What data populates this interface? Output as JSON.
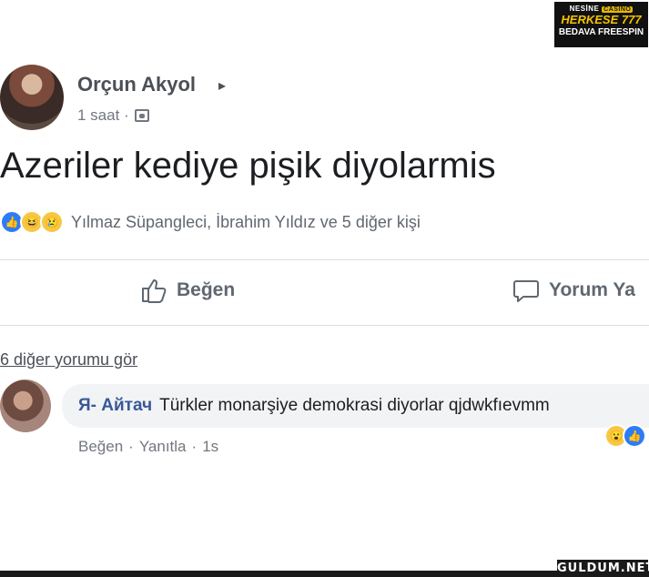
{
  "ad": {
    "brand": "NESİNE",
    "brand_tag": "CASINO",
    "line1": "HERKESE 777",
    "line2": "BEDAVA FREESPIN"
  },
  "post": {
    "author": "Orçun Akyol",
    "author_arrow": "▸",
    "time": "1 saat ·",
    "text": "Azeriler kediye pişik diyolarmis",
    "reactions_text": "Yılmaz Süpangleci, İbrahim Yıldız ve 5 diğer kişi"
  },
  "actions": {
    "like": "Beğen",
    "comment": "Yorum Ya"
  },
  "comments": {
    "more": "6 diğer yorumu gör",
    "items": [
      {
        "author": "Я- Айтач",
        "text": "Türkler monarşiye demokrasi diyorlar qjdwkfıevmm",
        "like": "Beğen",
        "sep1": "·",
        "reply": "Yanıtla",
        "sep2": "·",
        "time": "1s"
      }
    ]
  },
  "watermark": "GULDUM.NET",
  "colors": {
    "link": "#385898",
    "like_blue": "#2d7cf6",
    "emoji_yellow": "#f7c744"
  }
}
